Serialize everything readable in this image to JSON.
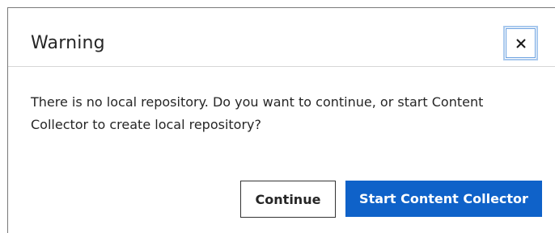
{
  "dialog": {
    "title": "Warning",
    "close_icon": "close-icon",
    "message": "There is no local repository. Do you want to continue, or start Content Collector to create local repository?",
    "buttons": {
      "continue_label": "Continue",
      "start_label": "Start Content Collector"
    },
    "colors": {
      "primary": "#0f62c9",
      "focus_ring": "#a9c9ee",
      "text": "#262626"
    }
  }
}
